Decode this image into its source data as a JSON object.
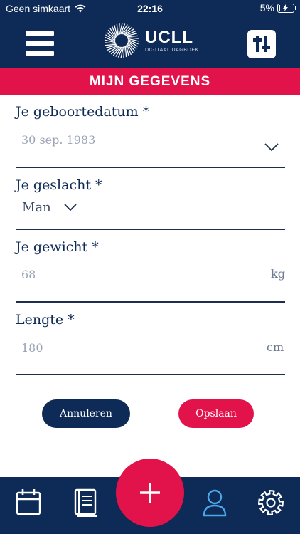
{
  "status": {
    "carrier": "Geen simkaart",
    "time": "22:16",
    "battery": "5%"
  },
  "header": {
    "brand": "UCLL",
    "subtitle": "DIGITAAL DAGBOEK",
    "menu_icon": "hamburger-icon",
    "filter_icon": "sliders-icon"
  },
  "page_title": "MIJN GEGEVENS",
  "form": {
    "birthdate": {
      "label": "Je geboortedatum *",
      "value": "30 sep. 1983"
    },
    "gender": {
      "label": "Je geslacht *",
      "value": "Man"
    },
    "weight": {
      "label": "Je gewicht *",
      "value": "68",
      "unit": "kg"
    },
    "height": {
      "label": "Lengte *",
      "value": "180",
      "unit": "cm"
    }
  },
  "actions": {
    "cancel": "Annuleren",
    "save": "Opslaan"
  },
  "tabs": [
    "calendar-icon",
    "diary-book-icon",
    "add-icon",
    "profile-icon",
    "settings-icon"
  ],
  "colors": {
    "navy": "#0e2a56",
    "accent": "#e2134b",
    "muted_text": "#9aa4b6"
  }
}
